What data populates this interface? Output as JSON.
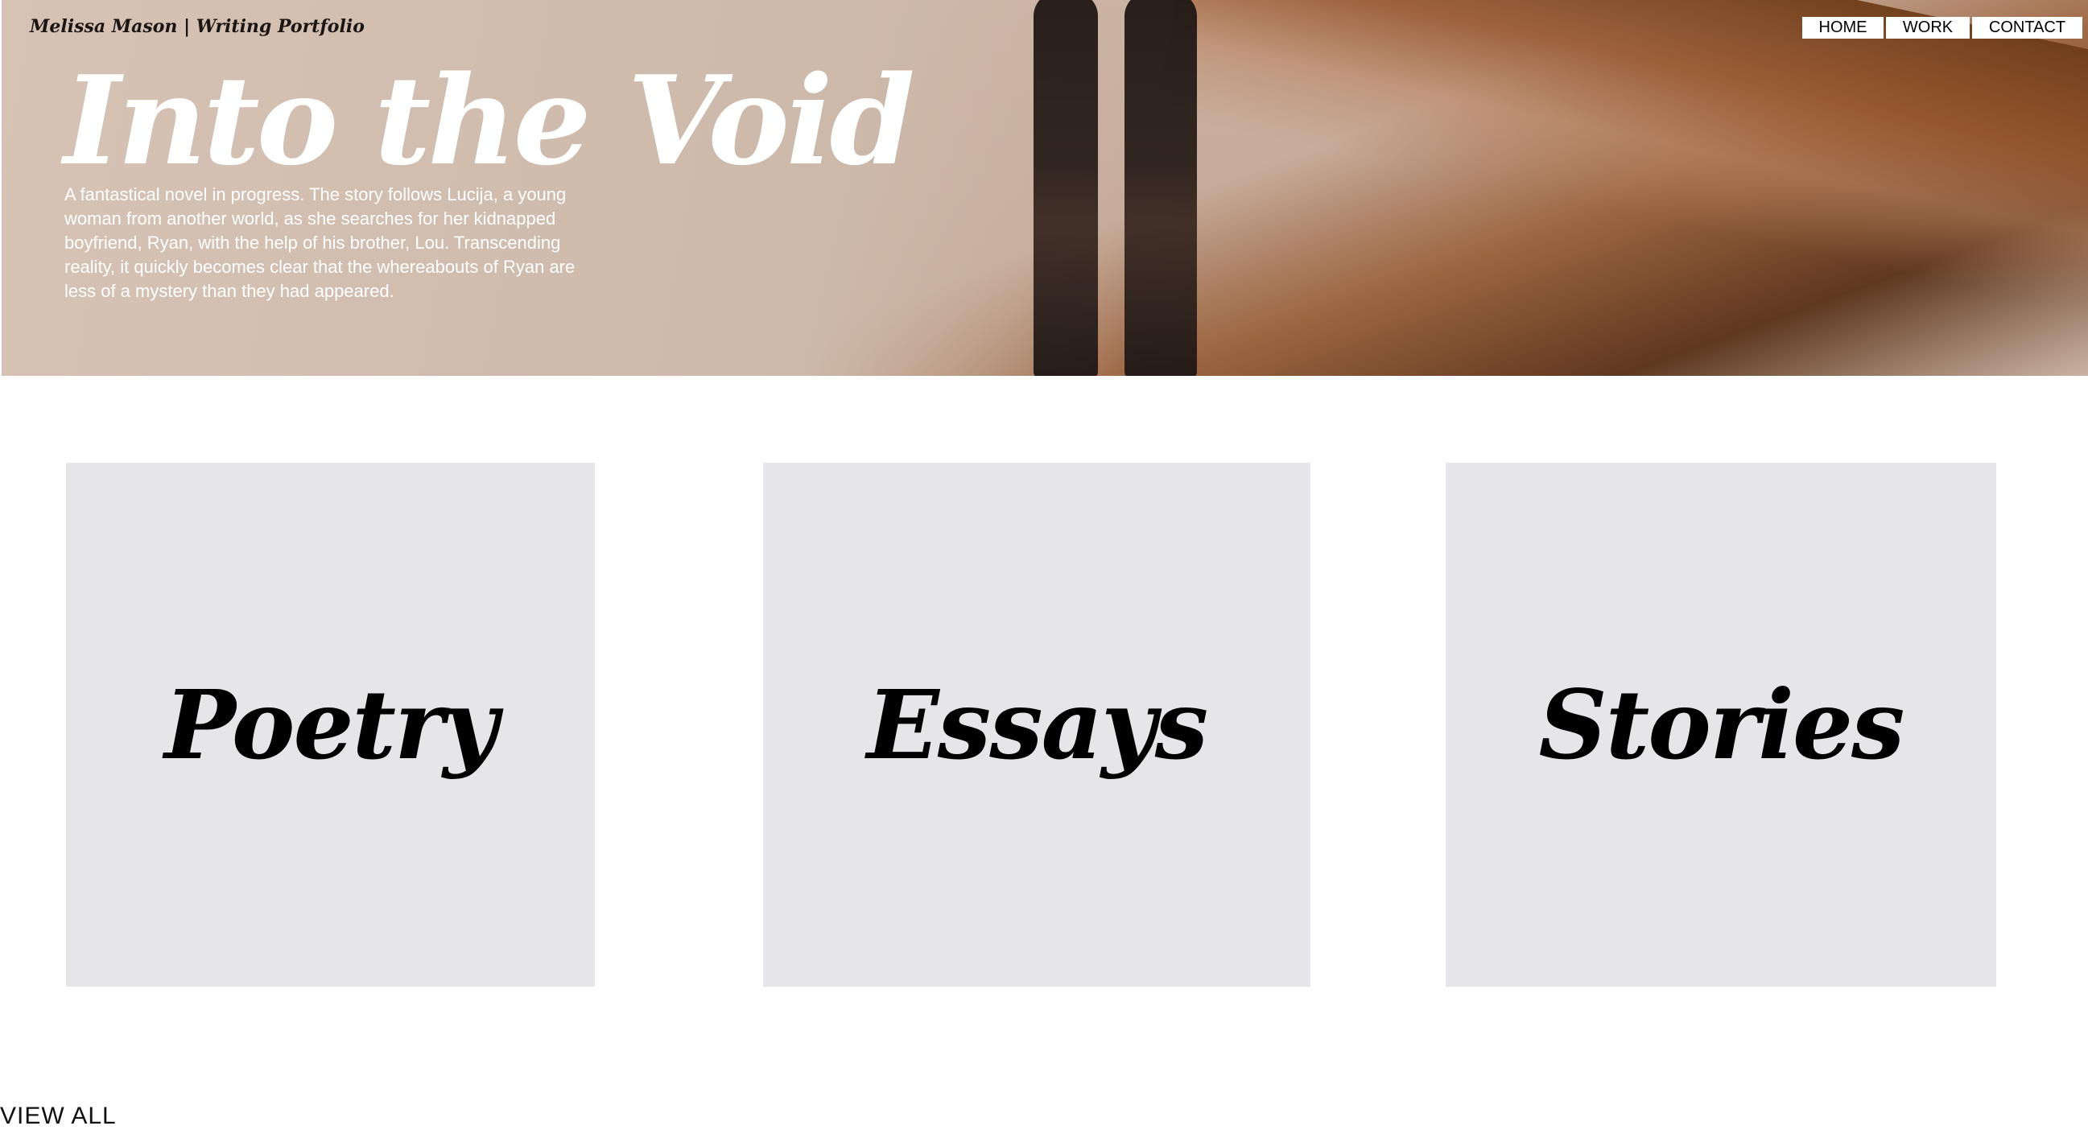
{
  "site": {
    "brand": "Melissa Mason | Writing Portfolio"
  },
  "nav": {
    "items": [
      {
        "label": "HOME"
      },
      {
        "label": "WORK"
      },
      {
        "label": "CONTACT"
      }
    ]
  },
  "hero": {
    "title": "Into the Void",
    "description": "A fantastical novel in progress. The story follows Lucija, a young woman from another world, as she searches for her kidnapped boyfriend, Ryan, with the help of his brother, Lou. Transcending reality, it quickly becomes clear that the whereabouts of Ryan are less of a mystery than they had appeared."
  },
  "categories": [
    {
      "label": "Poetry"
    },
    {
      "label": "Essays"
    },
    {
      "label": "Stories"
    }
  ],
  "footer": {
    "view_all": "VIEW ALL"
  }
}
